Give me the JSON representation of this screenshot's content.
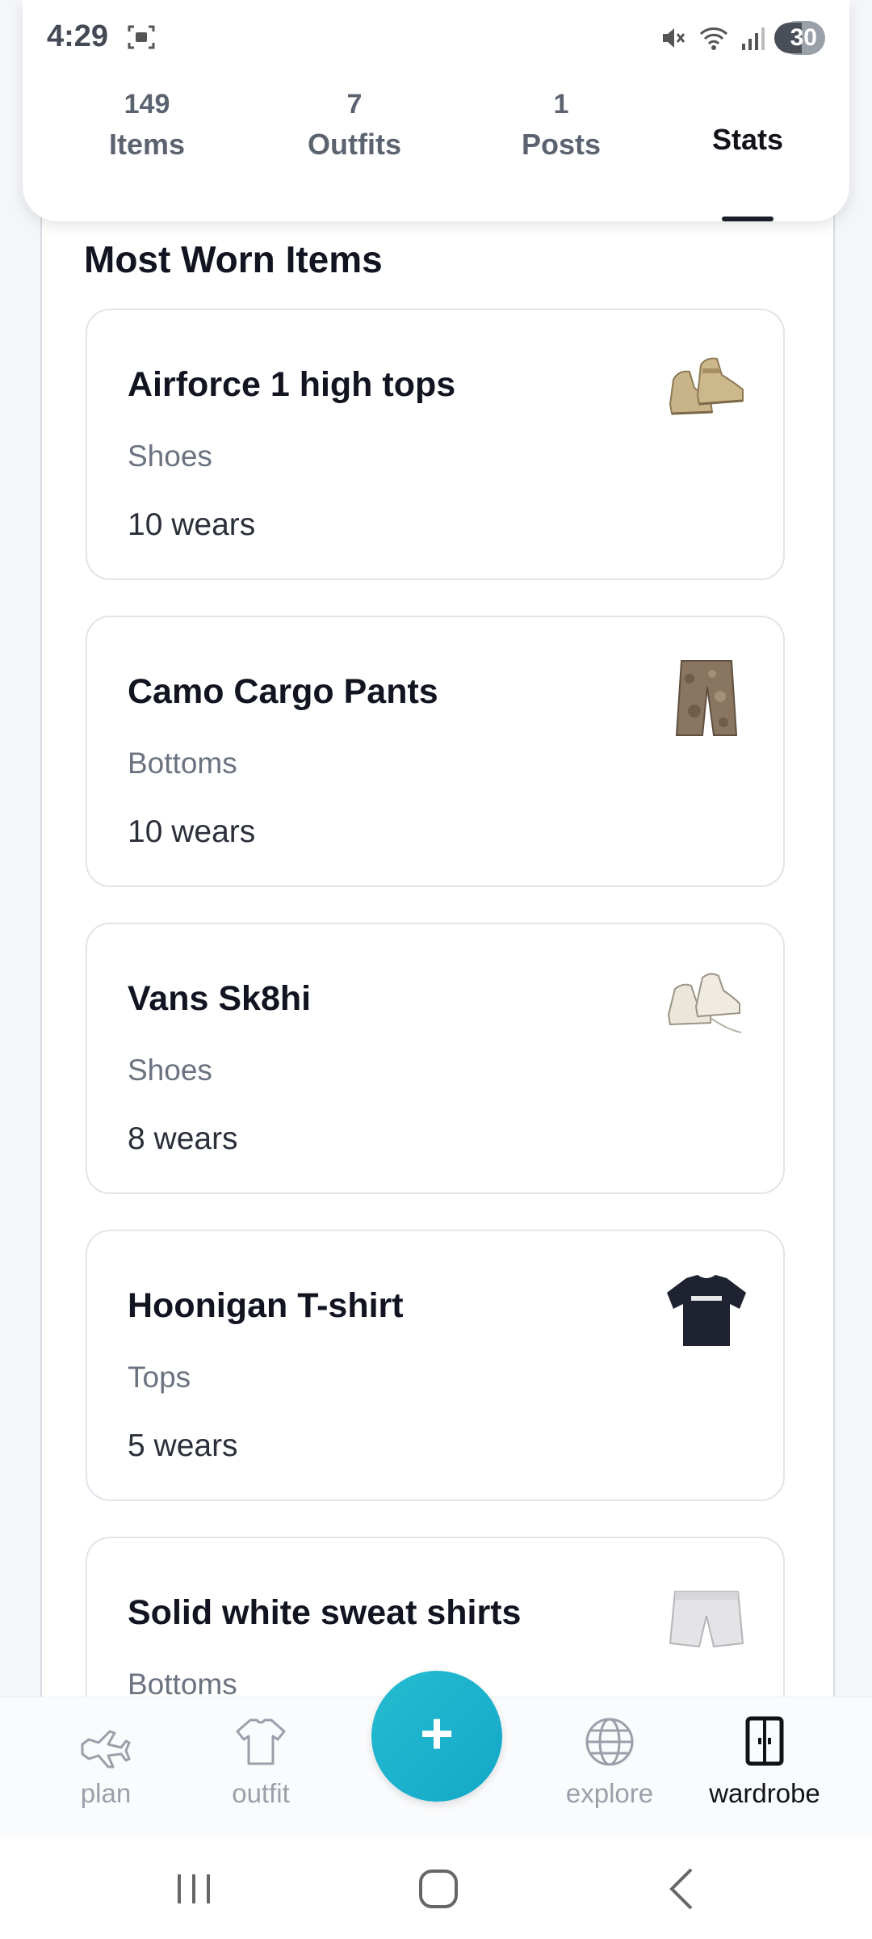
{
  "status_bar": {
    "time": "4:29",
    "battery": "30"
  },
  "tabs": [
    {
      "count": "149",
      "label": "Items"
    },
    {
      "count": "7",
      "label": "Outfits"
    },
    {
      "count": "1",
      "label": "Posts"
    },
    {
      "count": "",
      "label": "Stats"
    }
  ],
  "section_title": "Most Worn Items",
  "items": [
    {
      "name": "Airforce 1 high tops",
      "category": "Shoes",
      "wears": "10 wears",
      "thumb": "sneaker-icon"
    },
    {
      "name": "Camo Cargo Pants",
      "category": "Bottoms",
      "wears": "10 wears",
      "thumb": "pants-icon"
    },
    {
      "name": "Vans Sk8hi",
      "category": "Shoes",
      "wears": "8 wears",
      "thumb": "sneaker-icon"
    },
    {
      "name": "Hoonigan T-shirt",
      "category": "Tops",
      "wears": "5 wears",
      "thumb": "tshirt-icon"
    },
    {
      "name": "Solid white sweat shirts",
      "category": "Bottoms",
      "wears": "",
      "thumb": "shorts-icon"
    }
  ],
  "bottom_nav": {
    "plan": "plan",
    "outfit": "outfit",
    "add": "+",
    "explore": "explore",
    "wardrobe": "wardrobe"
  },
  "colors": {
    "accent": "#1bb0cc",
    "text": "#121521",
    "muted": "#6b7280"
  }
}
